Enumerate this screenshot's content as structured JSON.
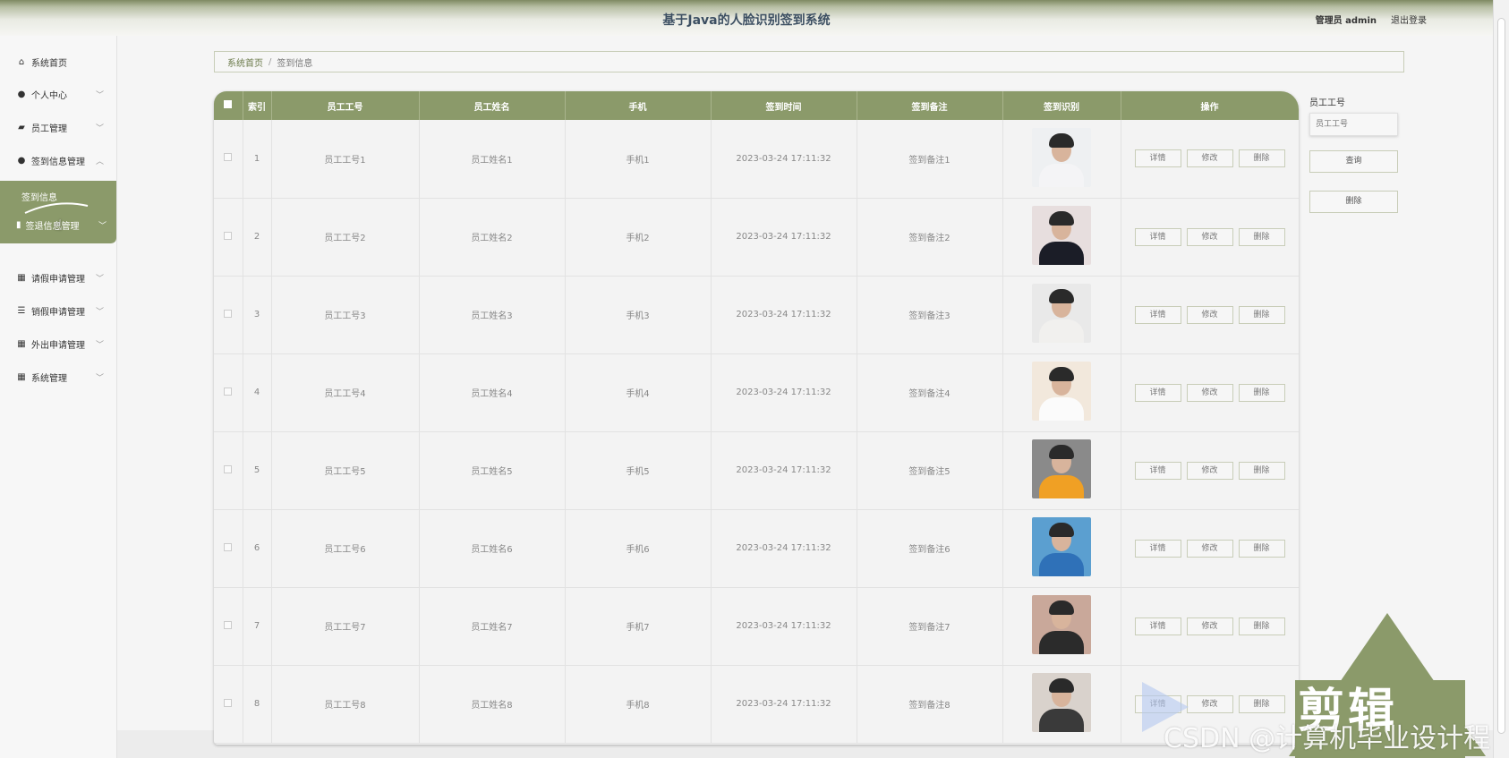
{
  "header": {
    "title": "基于Java的人脸识别签到系统",
    "user_label": "管理员 admin",
    "logout_label": "退出登录"
  },
  "sidebar": {
    "items": [
      {
        "label": "系统首页",
        "icon": "home-icon",
        "has_chevron": false
      },
      {
        "label": "个人中心",
        "icon": "user-icon",
        "has_chevron": true
      },
      {
        "label": "员工管理",
        "icon": "chart-icon",
        "has_chevron": true
      },
      {
        "label": "签到信息管理",
        "icon": "user-icon",
        "has_chevron": true,
        "expanded": true
      },
      {
        "label": "请假申请管理",
        "icon": "grid-icon",
        "has_chevron": true
      },
      {
        "label": "销假申请管理",
        "icon": "sliders-icon",
        "has_chevron": true
      },
      {
        "label": "外出申请管理",
        "icon": "grid-icon",
        "has_chevron": true
      },
      {
        "label": "系统管理",
        "icon": "grid-icon",
        "has_chevron": true
      }
    ],
    "active_sub": "签到信息",
    "active_group_label": "签退信息管理"
  },
  "breadcrumb": {
    "home": "系统首页",
    "separator": "/",
    "current": "签到信息"
  },
  "table": {
    "columns": [
      "索引",
      "员工工号",
      "员工姓名",
      "手机",
      "签到时间",
      "签到备注",
      "签到识别",
      "操作"
    ],
    "rows": [
      {
        "index": "1",
        "emp_no": "员工工号1",
        "emp_name": "员工姓名1",
        "phone": "手机1",
        "time": "2023-03-24 17:11:32",
        "remark": "签到备注1"
      },
      {
        "index": "2",
        "emp_no": "员工工号2",
        "emp_name": "员工姓名2",
        "phone": "手机2",
        "time": "2023-03-24 17:11:32",
        "remark": "签到备注2"
      },
      {
        "index": "3",
        "emp_no": "员工工号3",
        "emp_name": "员工姓名3",
        "phone": "手机3",
        "time": "2023-03-24 17:11:32",
        "remark": "签到备注3"
      },
      {
        "index": "4",
        "emp_no": "员工工号4",
        "emp_name": "员工姓名4",
        "phone": "手机4",
        "time": "2023-03-24 17:11:32",
        "remark": "签到备注4"
      },
      {
        "index": "5",
        "emp_no": "员工工号5",
        "emp_name": "员工姓名5",
        "phone": "手机5",
        "time": "2023-03-24 17:11:32",
        "remark": "签到备注5"
      },
      {
        "index": "6",
        "emp_no": "员工工号6",
        "emp_name": "员工姓名6",
        "phone": "手机6",
        "time": "2023-03-24 17:11:32",
        "remark": "签到备注6"
      },
      {
        "index": "7",
        "emp_no": "员工工号7",
        "emp_name": "员工姓名7",
        "phone": "手机7",
        "time": "2023-03-24 17:11:32",
        "remark": "签到备注7"
      },
      {
        "index": "8",
        "emp_no": "员工工号8",
        "emp_name": "员工姓名8",
        "phone": "手机8",
        "time": "2023-03-24 17:11:32",
        "remark": "签到备注8"
      }
    ],
    "actions": {
      "detail": "详情",
      "edit": "修改",
      "delete": "删除"
    }
  },
  "search_panel": {
    "label": "员工工号",
    "placeholder": "员工工号",
    "query_button": "查询",
    "delete_button": "删除"
  },
  "watermark": {
    "brand": "剪辑",
    "csdn": "CSDN @计算机毕业设计程"
  },
  "colors": {
    "accent": "#8b9a6a",
    "header_text": "#3c4f62"
  }
}
